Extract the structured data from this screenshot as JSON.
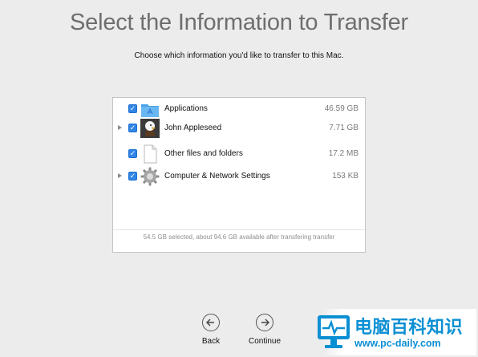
{
  "header": {
    "title": "Select the Information to Transfer",
    "subtitle": "Choose which information you'd like to transfer to this Mac."
  },
  "items": [
    {
      "label": "Applications",
      "size": "46.59 GB",
      "checked": true,
      "expandable": false,
      "icon": "applications-folder-icon"
    },
    {
      "label": "John Appleseed",
      "size": "7.71 GB",
      "checked": true,
      "expandable": true,
      "icon": "user-eagle-avatar-icon"
    },
    {
      "label": "Other files and folders",
      "size": "17.2 MB",
      "checked": true,
      "expandable": false,
      "icon": "document-file-icon"
    },
    {
      "label": "Computer & Network Settings",
      "size": "153 KB",
      "checked": true,
      "expandable": true,
      "icon": "gear-icon"
    }
  ],
  "summary": "54.5 GB selected, about 94.6 GB available after transfering transfer",
  "nav": {
    "back_label": "Back",
    "continue_label": "Continue"
  },
  "watermark": {
    "name": "电脑百科知识",
    "url": "www.pc-daily.com"
  },
  "colors": {
    "accent": "#2f86e7",
    "background": "#ececec",
    "watermark": "#0b8fd3"
  }
}
